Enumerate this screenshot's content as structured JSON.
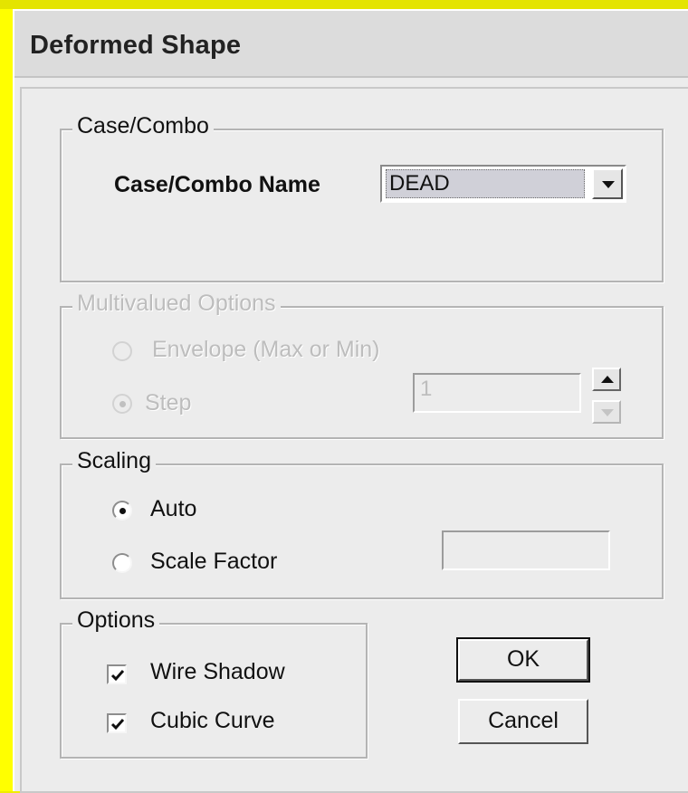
{
  "dialog": {
    "title": "Deformed Shape"
  },
  "case_combo": {
    "group_label": "Case/Combo",
    "name_label": "Case/Combo Name",
    "selected_value": "DEAD",
    "dropdown_icon": "chevron-down-icon"
  },
  "multivalued": {
    "group_label": "Multivalued Options",
    "envelope_label": "Envelope (Max or Min)",
    "step_label": "Step",
    "step_value": "1",
    "selected": "Step",
    "enabled": false
  },
  "scaling": {
    "group_label": "Scaling",
    "auto_label": "Auto",
    "scale_factor_label": "Scale Factor",
    "scale_factor_value": "",
    "selected": "Auto"
  },
  "options": {
    "group_label": "Options",
    "wire_shadow_label": "Wire Shadow",
    "wire_shadow_checked": true,
    "cubic_curve_label": "Cubic Curve",
    "cubic_curve_checked": true
  },
  "buttons": {
    "ok": "OK",
    "cancel": "Cancel"
  },
  "colors": {
    "background": "#f0ec00",
    "dialog": "#ececec",
    "disabled_text": "#bdbdbd"
  }
}
